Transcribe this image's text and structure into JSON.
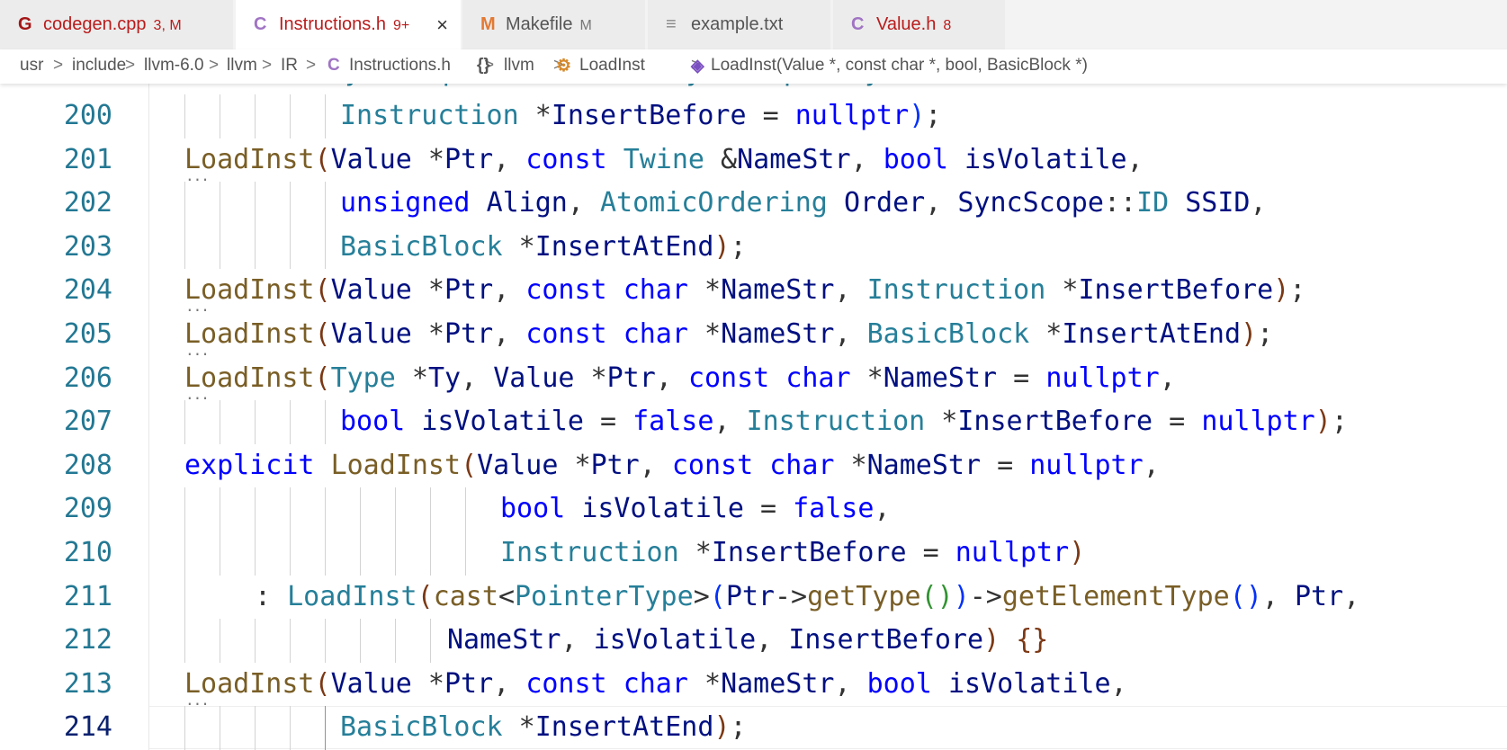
{
  "tabs": [
    {
      "icon": "G",
      "icon_color": "#a31515",
      "name": "codegen.cpp",
      "name_color": "#b91c1c",
      "badge": "3, M",
      "badge_color": "#b91c1c",
      "active": false
    },
    {
      "icon": "C",
      "icon_color": "#a074c4",
      "name": "Instructions.h",
      "name_color": "#b91c1c",
      "badge": "9+",
      "badge_color": "#b91c1c",
      "active": true,
      "close": "×"
    },
    {
      "icon": "M",
      "icon_color": "#e37933",
      "name": "Makefile",
      "name_color": "#555555",
      "badge": "M",
      "badge_color": "#777777",
      "active": false
    },
    {
      "icon": "≡",
      "icon_color": "#888888",
      "name": "example.txt",
      "name_color": "#555555",
      "badge": "",
      "badge_color": "#777777",
      "active": false
    },
    {
      "icon": "C",
      "icon_color": "#a074c4",
      "name": "Value.h",
      "name_color": "#b91c1c",
      "badge": "8",
      "badge_color": "#b91c1c",
      "active": false
    }
  ],
  "breadcrumb": {
    "segments": [
      "usr",
      "include",
      "llvm-6.0",
      "llvm",
      "IR",
      "Instructions.h",
      "llvm",
      "LoadInst",
      "LoadInst(Value *, const char *, bool, BasicBlock *)"
    ],
    "separator": ">",
    "file_icon": "C",
    "namespace_icon": "{}",
    "class_icon": "class-icon",
    "method_icon": "method-cube-icon"
  },
  "editor": {
    "partial_top_line": "SyncScope::ID SSID = SyncScope::System,",
    "current_line": "214",
    "lines": [
      {
        "num": "200",
        "guides": 5,
        "tokens": [
          [
            "Instruction",
            "t"
          ],
          [
            " *",
            "o"
          ],
          [
            "InsertBefore",
            "v"
          ],
          [
            " = ",
            "o"
          ],
          [
            "nullptr",
            "k"
          ],
          [
            ")",
            "b1"
          ],
          [
            ";",
            "p"
          ]
        ],
        "indent": 4
      },
      {
        "num": "201",
        "guides": 0,
        "tokens": [
          [
            "LoadInst",
            "f"
          ],
          [
            "(",
            "b3"
          ],
          [
            "Value",
            "v"
          ],
          [
            " *",
            "o"
          ],
          [
            "Ptr",
            "v"
          ],
          [
            ", ",
            "p"
          ],
          [
            "const",
            "k"
          ],
          [
            " ",
            "p"
          ],
          [
            "Twine",
            "t"
          ],
          [
            " &",
            "o"
          ],
          [
            "NameStr",
            "v"
          ],
          [
            ", ",
            "p"
          ],
          [
            "bool",
            "k"
          ],
          [
            " ",
            "p"
          ],
          [
            "isVolatile",
            "v"
          ],
          [
            ",",
            "p"
          ]
        ],
        "indent": 0,
        "dots": true
      },
      {
        "num": "202",
        "guides": 5,
        "tokens": [
          [
            "unsigned",
            "k"
          ],
          [
            " ",
            "p"
          ],
          [
            "Align",
            "v"
          ],
          [
            ", ",
            "p"
          ],
          [
            "AtomicOrdering",
            "t"
          ],
          [
            " ",
            "p"
          ],
          [
            "Order",
            "v"
          ],
          [
            ", ",
            "p"
          ],
          [
            "SyncScope",
            "v"
          ],
          [
            "::",
            "o"
          ],
          [
            "ID",
            "t"
          ],
          [
            " ",
            "p"
          ],
          [
            "SSID",
            "v"
          ],
          [
            ",",
            "p"
          ]
        ],
        "indent": 4
      },
      {
        "num": "203",
        "guides": 5,
        "tokens": [
          [
            "BasicBlock",
            "t"
          ],
          [
            " *",
            "o"
          ],
          [
            "InsertAtEnd",
            "v"
          ],
          [
            ")",
            "b3"
          ],
          [
            ";",
            "p"
          ]
        ],
        "indent": 4
      },
      {
        "num": "204",
        "guides": 0,
        "tokens": [
          [
            "LoadInst",
            "f"
          ],
          [
            "(",
            "b3"
          ],
          [
            "Value",
            "v"
          ],
          [
            " *",
            "o"
          ],
          [
            "Ptr",
            "v"
          ],
          [
            ", ",
            "p"
          ],
          [
            "const",
            "k"
          ],
          [
            " ",
            "p"
          ],
          [
            "char",
            "k"
          ],
          [
            " *",
            "o"
          ],
          [
            "NameStr",
            "v"
          ],
          [
            ", ",
            "p"
          ],
          [
            "Instruction",
            "t"
          ],
          [
            " *",
            "o"
          ],
          [
            "InsertBefore",
            "v"
          ],
          [
            ")",
            "b3"
          ],
          [
            ";",
            "p"
          ]
        ],
        "indent": 0,
        "dots": true
      },
      {
        "num": "205",
        "guides": 0,
        "tokens": [
          [
            "LoadInst",
            "f"
          ],
          [
            "(",
            "b3"
          ],
          [
            "Value",
            "v"
          ],
          [
            " *",
            "o"
          ],
          [
            "Ptr",
            "v"
          ],
          [
            ", ",
            "p"
          ],
          [
            "const",
            "k"
          ],
          [
            " ",
            "p"
          ],
          [
            "char",
            "k"
          ],
          [
            " *",
            "o"
          ],
          [
            "NameStr",
            "v"
          ],
          [
            ", ",
            "p"
          ],
          [
            "BasicBlock",
            "t"
          ],
          [
            " *",
            "o"
          ],
          [
            "InsertAtEnd",
            "v"
          ],
          [
            ")",
            "b3"
          ],
          [
            ";",
            "p"
          ]
        ],
        "indent": 0,
        "dots": true
      },
      {
        "num": "206",
        "guides": 0,
        "tokens": [
          [
            "LoadInst",
            "f"
          ],
          [
            "(",
            "b3"
          ],
          [
            "Type",
            "t"
          ],
          [
            " *",
            "o"
          ],
          [
            "Ty",
            "v"
          ],
          [
            ", ",
            "p"
          ],
          [
            "Value",
            "v"
          ],
          [
            " *",
            "o"
          ],
          [
            "Ptr",
            "v"
          ],
          [
            ", ",
            "p"
          ],
          [
            "const",
            "k"
          ],
          [
            " ",
            "p"
          ],
          [
            "char",
            "k"
          ],
          [
            " *",
            "o"
          ],
          [
            "NameStr",
            "v"
          ],
          [
            " = ",
            "o"
          ],
          [
            "nullptr",
            "k"
          ],
          [
            ",",
            "p"
          ]
        ],
        "indent": 0,
        "dots": true
      },
      {
        "num": "207",
        "guides": 5,
        "tokens": [
          [
            "bool",
            "k"
          ],
          [
            " ",
            "p"
          ],
          [
            "isVolatile",
            "v"
          ],
          [
            " = ",
            "o"
          ],
          [
            "false",
            "k"
          ],
          [
            ", ",
            "p"
          ],
          [
            "Instruction",
            "t"
          ],
          [
            " *",
            "o"
          ],
          [
            "InsertBefore",
            "v"
          ],
          [
            " = ",
            "o"
          ],
          [
            "nullptr",
            "k"
          ],
          [
            ")",
            "b3"
          ],
          [
            ";",
            "p"
          ]
        ],
        "indent": 4
      },
      {
        "num": "208",
        "guides": 0,
        "tokens": [
          [
            "explicit",
            "k"
          ],
          [
            " ",
            "p"
          ],
          [
            "LoadInst",
            "f"
          ],
          [
            "(",
            "b3"
          ],
          [
            "Value",
            "v"
          ],
          [
            " *",
            "o"
          ],
          [
            "Ptr",
            "v"
          ],
          [
            ", ",
            "p"
          ],
          [
            "const",
            "k"
          ],
          [
            " ",
            "p"
          ],
          [
            "char",
            "k"
          ],
          [
            " *",
            "o"
          ],
          [
            "NameStr",
            "v"
          ],
          [
            " = ",
            "o"
          ],
          [
            "nullptr",
            "k"
          ],
          [
            ",",
            "p"
          ]
        ],
        "indent": 0
      },
      {
        "num": "209",
        "guides": 9,
        "tokens": [
          [
            "bool",
            "k"
          ],
          [
            " ",
            "p"
          ],
          [
            "isVolatile",
            "v"
          ],
          [
            " = ",
            "o"
          ],
          [
            "false",
            "k"
          ],
          [
            ",",
            "p"
          ]
        ],
        "indent": 9
      },
      {
        "num": "210",
        "guides": 9,
        "tokens": [
          [
            "Instruction",
            "t"
          ],
          [
            " *",
            "o"
          ],
          [
            "InsertBefore",
            "v"
          ],
          [
            " = ",
            "o"
          ],
          [
            "nullptr",
            "k"
          ],
          [
            ")",
            "b3"
          ]
        ],
        "indent": 9
      },
      {
        "num": "211",
        "guides": 1,
        "tokens": [
          [
            ": ",
            "p"
          ],
          [
            "LoadInst",
            "t"
          ],
          [
            "(",
            "b3"
          ],
          [
            "cast",
            "f"
          ],
          [
            "<",
            "o"
          ],
          [
            "PointerType",
            "t"
          ],
          [
            ">",
            "o"
          ],
          [
            "(",
            "b1"
          ],
          [
            "Ptr",
            "v"
          ],
          [
            "->",
            "o"
          ],
          [
            "getType",
            "f"
          ],
          [
            "(",
            "b2"
          ],
          [
            ")",
            "b2"
          ],
          [
            ")",
            "b1"
          ],
          [
            "->",
            "o"
          ],
          [
            "getElementType",
            "f"
          ],
          [
            "(",
            "b1"
          ],
          [
            ")",
            "b1"
          ],
          [
            ", ",
            "p"
          ],
          [
            "Ptr",
            "v"
          ],
          [
            ",",
            "p"
          ]
        ],
        "indent": 2
      },
      {
        "num": "212",
        "guides": 8,
        "tokens": [
          [
            "NameStr",
            "v"
          ],
          [
            ", ",
            "p"
          ],
          [
            "isVolatile",
            "v"
          ],
          [
            ", ",
            "p"
          ],
          [
            "InsertBefore",
            "v"
          ],
          [
            ")",
            "b3"
          ],
          [
            " ",
            "p"
          ],
          [
            "{",
            "b3"
          ],
          [
            "}",
            "b3"
          ]
        ],
        "indent": 8
      },
      {
        "num": "213",
        "guides": 0,
        "tokens": [
          [
            "LoadInst",
            "f"
          ],
          [
            "(",
            "b3"
          ],
          [
            "Value",
            "v"
          ],
          [
            " *",
            "o"
          ],
          [
            "Ptr",
            "v"
          ],
          [
            ", ",
            "p"
          ],
          [
            "const",
            "k"
          ],
          [
            " ",
            "p"
          ],
          [
            "char",
            "k"
          ],
          [
            " *",
            "o"
          ],
          [
            "NameStr",
            "v"
          ],
          [
            ", ",
            "p"
          ],
          [
            "bool",
            "k"
          ],
          [
            " ",
            "p"
          ],
          [
            "isVolatile",
            "v"
          ],
          [
            ",",
            "p"
          ]
        ],
        "indent": 0,
        "dots": true
      },
      {
        "num": "214",
        "guides": 5,
        "tokens": [
          [
            "BasicBlock",
            "t"
          ],
          [
            " *",
            "o"
          ],
          [
            "InsertAtEnd",
            "v"
          ],
          [
            ")",
            "b3"
          ],
          [
            ";",
            "p"
          ]
        ],
        "indent": 4
      }
    ]
  }
}
